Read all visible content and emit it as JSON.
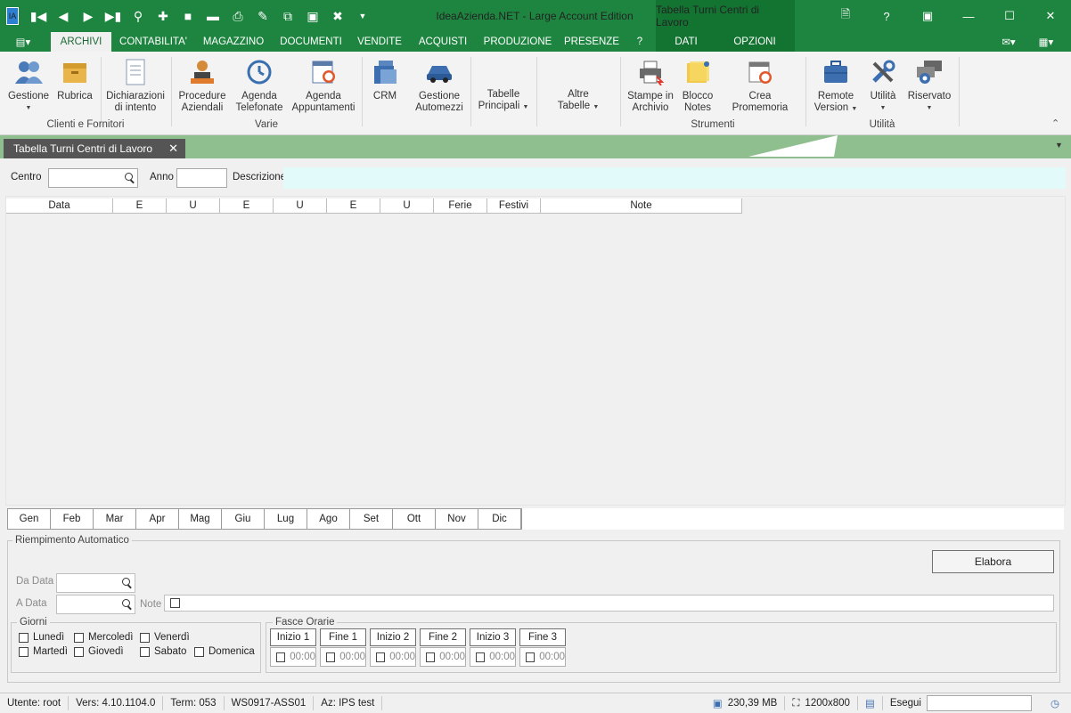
{
  "window": {
    "title": "IdeaAzienda.NET - Large Account Edition",
    "context_title": "Tabella Turni Centri di Lavoro",
    "controls": [
      "?",
      "□",
      "—",
      "☐",
      "✕"
    ]
  },
  "tabs": {
    "main": [
      "ARCHIVI",
      "CONTABILITA'",
      "MAGAZZINO",
      "DOCUMENTI",
      "VENDITE",
      "ACQUISTI",
      "PRODUZIONE",
      "PRESENZE",
      "?"
    ],
    "context": [
      "DATI",
      "OPZIONI"
    ]
  },
  "ribbon": {
    "groups": {
      "clienti": "Clienti e Fornitori",
      "varie": "Varie",
      "strumenti": "Strumenti",
      "utilita": "Utilità"
    },
    "buttons": {
      "gestione": "Gestione",
      "rubrica": "Rubrica",
      "dichiarazioni_1": "Dichiarazioni",
      "dichiarazioni_2": "di intento",
      "procedure_1": "Procedure",
      "procedure_2": "Aziendali",
      "agenda_tel_1": "Agenda",
      "agenda_tel_2": "Telefonate",
      "agenda_app_1": "Agenda",
      "agenda_app_2": "Appuntamenti",
      "crm": "CRM",
      "automezzi_1": "Gestione",
      "automezzi_2": "Automezzi",
      "tabelle_1": "Tabelle",
      "tabelle_2": "Principali",
      "altre_1": "Altre",
      "altre_2": "Tabelle",
      "stampe_1": "Stampe in",
      "stampe_2": "Archivio",
      "blocco_1": "Blocco",
      "blocco_2": "Notes",
      "promemoria": "Crea Promemoria",
      "remote_1": "Remote",
      "remote_2": "Version",
      "utilita": "Utilità",
      "riservato": "Riservato"
    }
  },
  "doc_tab": {
    "label": "Tabella Turni Centri di Lavoro"
  },
  "filters": {
    "centro": "Centro",
    "anno": "Anno",
    "descrizione": "Descrizione"
  },
  "grid": {
    "columns": [
      "Data",
      "E",
      "U",
      "E",
      "U",
      "E",
      "U",
      "Ferie",
      "Festivi",
      "Note"
    ]
  },
  "months": [
    "Gen",
    "Feb",
    "Mar",
    "Apr",
    "Mag",
    "Giu",
    "Lug",
    "Ago",
    "Set",
    "Ott",
    "Nov",
    "Dic"
  ],
  "auto_fill": {
    "title": "Riempimento Automatico",
    "da_data": "Da Data",
    "a_data": "A Data",
    "note": "Note",
    "elabora": "Elabora",
    "giorni_title": "Giorni",
    "giorni": [
      "Lunedì",
      "Martedì",
      "Mercoledì",
      "Giovedì",
      "Venerdì",
      "Sabato",
      "Domenica"
    ],
    "fasce_title": "Fasce Orarie",
    "fasce": [
      "Inizio 1",
      "Fine 1",
      "Inizio 2",
      "Fine 2",
      "Inizio 3",
      "Fine 3"
    ],
    "time_value": "00:00"
  },
  "status": {
    "utente": "Utente: root",
    "versione": "Vers: 4.10.1104.0",
    "term": "Term: 053",
    "workstation": "WS0917-ASS01",
    "azienda": "Az: IPS test",
    "memory": "230,39 MB",
    "resolution": "1200x800",
    "esegui": "Esegui"
  },
  "colors": {
    "accent": "#1e8540",
    "context": "#137432",
    "doc_strip": "#8fbf8f"
  }
}
